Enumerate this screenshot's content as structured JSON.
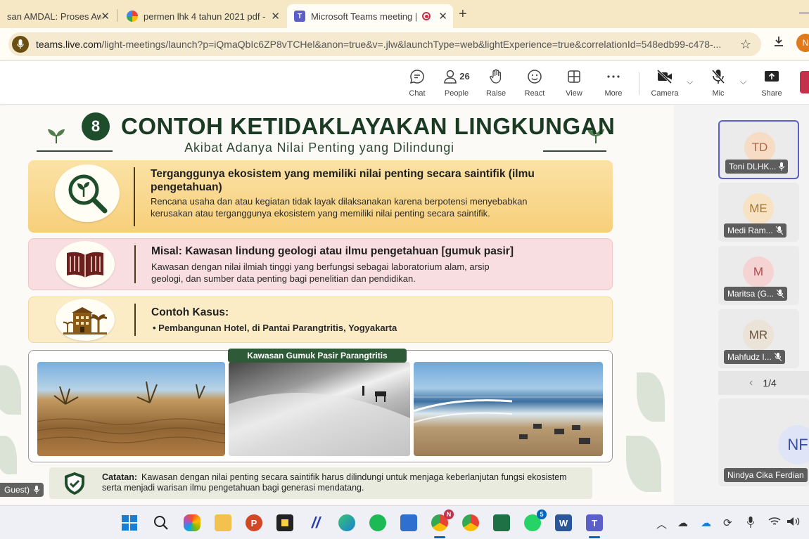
{
  "browser": {
    "tabs": [
      {
        "title": "san AMDAL: Proses Awal",
        "close": "✕"
      },
      {
        "title": "permen lhk 4 tahun 2021 pdf - ",
        "close": "✕"
      },
      {
        "title": "Microsoft Teams meeting | M",
        "close": "✕"
      }
    ],
    "new_tab": "+",
    "url_host": "teams.live.com",
    "url_rest": "/light-meetings/launch?p=iQmaQbIc6ZP8vTCHel&anon=true&v=.jlw&launchType=web&lightExperience=true&correlationId=548edb99-c478-...",
    "profile_initial": "N"
  },
  "teams_toolbar": {
    "chat": "Chat",
    "people": "People",
    "people_count": "26",
    "raise": "Raise",
    "react": "React",
    "view": "View",
    "more": "More",
    "camera": "Camera",
    "mic": "Mic",
    "share": "Share"
  },
  "slide": {
    "number": "8",
    "title": "CONTOH KETIDAKLAYAKAN LINGKUNGAN",
    "subtitle": "Akibat Adanya Nilai Penting yang Dilindungi",
    "panel1": {
      "title": "Terganggunya ekosistem yang memiliki nilai penting secara saintifik (ilmu pengetahuan)",
      "body": "Rencana usaha dan atau kegiatan tidak layak dilaksanakan karena berpotensi menyebabkan kerusakan atau terganggunya ekosistem yang memiliki nilai penting secara saintifik."
    },
    "panel2": {
      "title": "Misal: Kawasan lindung geologi atau ilmu pengetahuan [gumuk pasir]",
      "body": "Kawasan dengan nilai ilmiah tinggi yang berfungsi sebagai laboratorium alam, arsip geologi, dan sumber data penting bagi penelitian dan pendidikan."
    },
    "panel3": {
      "title": "Contoh Kasus:",
      "bullet": "Pembangunan Hotel, di Pantai Parangtritis, Yogyakarta"
    },
    "photo_caption": "Kawasan Gumuk Pasir Parangtritis",
    "note_label": "Catatan:",
    "note_text": "Kawasan dengan nilai penting secara saintifik harus dilindungi untuk menjaga keberlanjutan fungsi ekosistem serta menjadi warisan ilmu pengetahuan bagi generasi mendatang."
  },
  "self_tag": "Guest)",
  "participants": [
    {
      "initials": "TD",
      "name": "Toni DLHK...",
      "color": "#f6dcc4",
      "text_color": "#b0684a",
      "selected": true,
      "mic": "on"
    },
    {
      "initials": "ME",
      "name": "Medi Ram...",
      "color": "#f7e3c3",
      "text_color": "#a9742d",
      "selected": false,
      "mic": "muted"
    },
    {
      "initials": "M",
      "name": "Maritsa (G...",
      "color": "#f6d3d3",
      "text_color": "#b04a4a",
      "selected": false,
      "mic": "muted"
    },
    {
      "initials": "MR",
      "name": "Mahfudz I...",
      "color": "#ebe2d8",
      "text_color": "#6b5440",
      "selected": false,
      "mic": "muted"
    }
  ],
  "pager": "1/4",
  "spotlight": {
    "initials": "NF",
    "name": "Nindya Cika Ferdian",
    "color": "#dfe4f7",
    "text_color": "#3b4ea0"
  },
  "taskbar": {
    "chrome_badge": "N",
    "whatsapp_badge": "5"
  }
}
